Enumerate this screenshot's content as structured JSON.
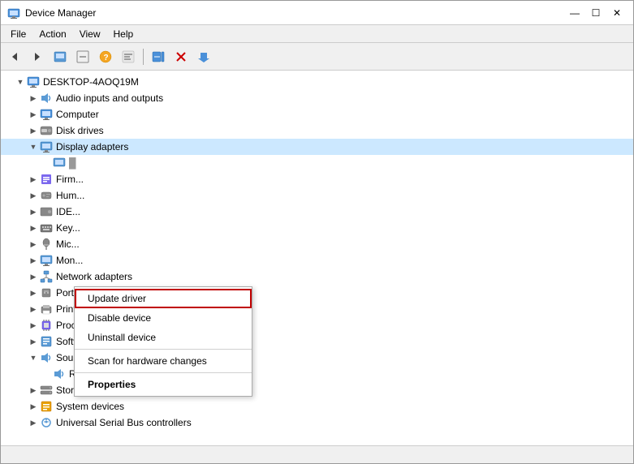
{
  "window": {
    "title": "Device Manager",
    "controls": {
      "minimize": "—",
      "maximize": "☐",
      "close": "✕"
    }
  },
  "menu": {
    "items": [
      "File",
      "Action",
      "View",
      "Help"
    ]
  },
  "toolbar": {
    "buttons": [
      "◀",
      "▶",
      "☰",
      "⊟",
      "?",
      "⊞",
      "🖥",
      "✕",
      "⬇"
    ]
  },
  "tree": {
    "root": "DESKTOP-4AOQ19M",
    "items": [
      {
        "id": "audio",
        "label": "Audio inputs and outputs",
        "indent": 1,
        "expanded": false,
        "icon": "🔊"
      },
      {
        "id": "computer",
        "label": "Computer",
        "indent": 1,
        "expanded": false,
        "icon": "🖥"
      },
      {
        "id": "disk",
        "label": "Disk drives",
        "indent": 1,
        "expanded": false,
        "icon": "💾"
      },
      {
        "id": "display",
        "label": "Display adapters",
        "indent": 1,
        "expanded": true,
        "icon": "🖥"
      },
      {
        "id": "display-child",
        "label": "",
        "indent": 2,
        "expanded": false,
        "icon": "🖥"
      },
      {
        "id": "firm",
        "label": "Firm...",
        "indent": 1,
        "expanded": false,
        "icon": "📋"
      },
      {
        "id": "hum",
        "label": "Hum...",
        "indent": 1,
        "expanded": false,
        "icon": "🖱"
      },
      {
        "id": "ide",
        "label": "IDE...",
        "indent": 1,
        "expanded": false,
        "icon": "📋"
      },
      {
        "id": "key",
        "label": "Key...",
        "indent": 1,
        "expanded": false,
        "icon": "⌨"
      },
      {
        "id": "mic",
        "label": "Mic...",
        "indent": 1,
        "expanded": false,
        "icon": "🎤"
      },
      {
        "id": "mon",
        "label": "Mon...",
        "indent": 1,
        "expanded": false,
        "icon": "🖥"
      },
      {
        "id": "network",
        "label": "Network adapters",
        "indent": 1,
        "expanded": false,
        "icon": "🌐"
      },
      {
        "id": "ports",
        "label": "Ports (COM & LPT)",
        "indent": 1,
        "expanded": false,
        "icon": "🔌"
      },
      {
        "id": "print",
        "label": "Print queues",
        "indent": 1,
        "expanded": false,
        "icon": "🖨"
      },
      {
        "id": "processors",
        "label": "Processors",
        "indent": 1,
        "expanded": false,
        "icon": "💻"
      },
      {
        "id": "software",
        "label": "Software devices",
        "indent": 1,
        "expanded": false,
        "icon": "📋"
      },
      {
        "id": "sound",
        "label": "Sound, video and game controllers",
        "indent": 1,
        "expanded": true,
        "icon": "🔊"
      },
      {
        "id": "realtek",
        "label": "Realtek High Definition Audio",
        "indent": 2,
        "expanded": false,
        "icon": "🔊"
      },
      {
        "id": "storage",
        "label": "Storage controllers",
        "indent": 1,
        "expanded": false,
        "icon": "💾"
      },
      {
        "id": "system",
        "label": "System devices",
        "indent": 1,
        "expanded": false,
        "icon": "📋"
      },
      {
        "id": "usb",
        "label": "Universal Serial Bus controllers",
        "indent": 1,
        "expanded": false,
        "icon": "🔌"
      }
    ]
  },
  "context_menu": {
    "items": [
      {
        "id": "update",
        "label": "Update driver",
        "active": true,
        "bold": false
      },
      {
        "id": "disable",
        "label": "Disable device",
        "active": false,
        "bold": false
      },
      {
        "id": "uninstall",
        "label": "Uninstall device",
        "active": false,
        "bold": false
      },
      {
        "id": "sep",
        "type": "separator"
      },
      {
        "id": "scan",
        "label": "Scan for hardware changes",
        "active": false,
        "bold": false
      },
      {
        "id": "sep2",
        "type": "separator"
      },
      {
        "id": "properties",
        "label": "Properties",
        "active": false,
        "bold": true
      }
    ]
  }
}
